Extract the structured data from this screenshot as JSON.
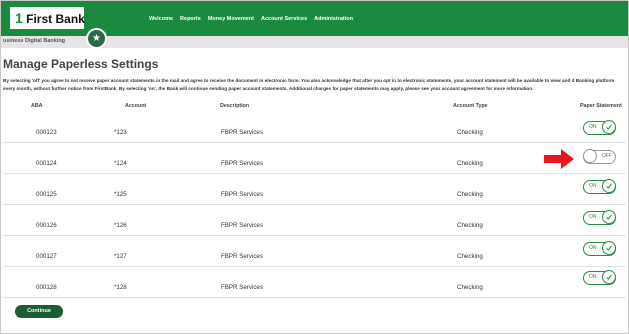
{
  "brand": {
    "logo_num": "1",
    "logo_word": "First Bank"
  },
  "nav": [
    "Welcome",
    "Reports",
    "Money Movement",
    "Account Services",
    "Administration"
  ],
  "app_name": "usiness Digital Banking",
  "page_title": "Manage Paperless Settings",
  "disclaimer": "By selecting 'off' you agree to not receive paper account statements in the mail and agree to receive the document in electronic form. You also acknowledge that after you opt in to electronic statements, your account statement will be available to view and d Banking platform every month, without further notice from FirstBank. By selecting 'on', the Bank will continue sending paper account statements. Additional charges for paper statements may apply, please see your account agreement for more information.",
  "columns": {
    "aba": "ABA",
    "account": "Account",
    "description": "Description",
    "account_type": "Account Type",
    "paper": "Paper Statement"
  },
  "rows": [
    {
      "aba": "000123",
      "account": "*123",
      "description": "FBPR Services",
      "type": "Checking",
      "toggle": "ON"
    },
    {
      "aba": "000124",
      "account": "*124",
      "description": "FBPR Services",
      "type": "Checking",
      "toggle": "OFF"
    },
    {
      "aba": "000125",
      "account": "*125",
      "description": "FBPR Services",
      "type": "Checking",
      "toggle": "ON"
    },
    {
      "aba": "000126",
      "account": "*126",
      "description": "FBPR Services",
      "type": "Checking",
      "toggle": "ON"
    },
    {
      "aba": "000127",
      "account": "*127",
      "description": "FBPR Services",
      "type": "Checking",
      "toggle": "ON"
    },
    {
      "aba": "000128",
      "account": "*128",
      "description": "FBPR Services",
      "type": "Checking",
      "toggle": "ON"
    }
  ],
  "continue_label": "Continue",
  "colors": {
    "brand_green": "#1b8a3e",
    "button_green": "#1b5e34",
    "arrow_red": "#e8161c"
  },
  "icons": {
    "star": "star-icon",
    "check": "check-icon",
    "arrow": "arrow-right-icon"
  }
}
